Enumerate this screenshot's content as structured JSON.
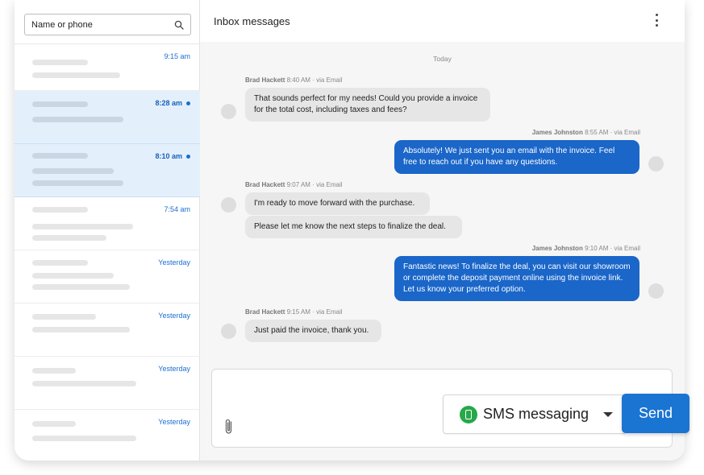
{
  "sidebar": {
    "search": {
      "placeholder": "Name or phone"
    },
    "conversations": [
      {
        "time": "9:15 am",
        "unread": false,
        "selected": false
      },
      {
        "time": "8:28 am",
        "unread": true,
        "selected": true
      },
      {
        "time": "8:10 am",
        "unread": true,
        "selected": true
      },
      {
        "time": "7:54 am",
        "unread": false,
        "selected": false
      },
      {
        "time": "Yesterday",
        "unread": false,
        "selected": false
      },
      {
        "time": "Yesterday",
        "unread": false,
        "selected": false
      },
      {
        "time": "Yesterday",
        "unread": false,
        "selected": false
      },
      {
        "time": "Yesterday",
        "unread": false,
        "selected": false
      }
    ]
  },
  "header": {
    "title": "Inbox messages"
  },
  "thread": {
    "date_label": "Today",
    "messages": [
      {
        "sender": "Brad Hackett",
        "time": "8:40 AM",
        "channel": "via Email",
        "direction": "in",
        "bubbles": [
          "That sounds perfect for my needs! Could you provide a invoice for the total cost, including taxes and fees?"
        ]
      },
      {
        "sender": "James Johnston",
        "time": "8:55 AM",
        "channel": "via Email",
        "direction": "out",
        "bubbles": [
          "Absolutely! We just sent you an email with the invoice. Feel free to reach out if you have any questions."
        ]
      },
      {
        "sender": "Brad Hackett",
        "time": "9:07 AM",
        "channel": "via Email",
        "direction": "in",
        "bubbles": [
          "I'm ready to move forward with the purchase.",
          "Please let me know the next steps to finalize the deal."
        ]
      },
      {
        "sender": "James Johnston",
        "time": "9:10 AM",
        "channel": "via Email",
        "direction": "out",
        "bubbles": [
          "Fantastic news! To finalize the deal, you can visit our showroom or complete the deposit payment online using the invoice link. Let us know your preferred option."
        ]
      },
      {
        "sender": "Brad Hackett",
        "time": "9:15 AM",
        "channel": "via Email",
        "direction": "in",
        "bubbles": [
          "Just paid the invoice, thank you."
        ]
      }
    ]
  },
  "composer": {
    "channel_label": "SMS messaging",
    "send_label": "Send"
  },
  "colors": {
    "accent": "#1a66c9",
    "selected_row": "#e3f0fc",
    "sms_green": "#27a84a"
  }
}
